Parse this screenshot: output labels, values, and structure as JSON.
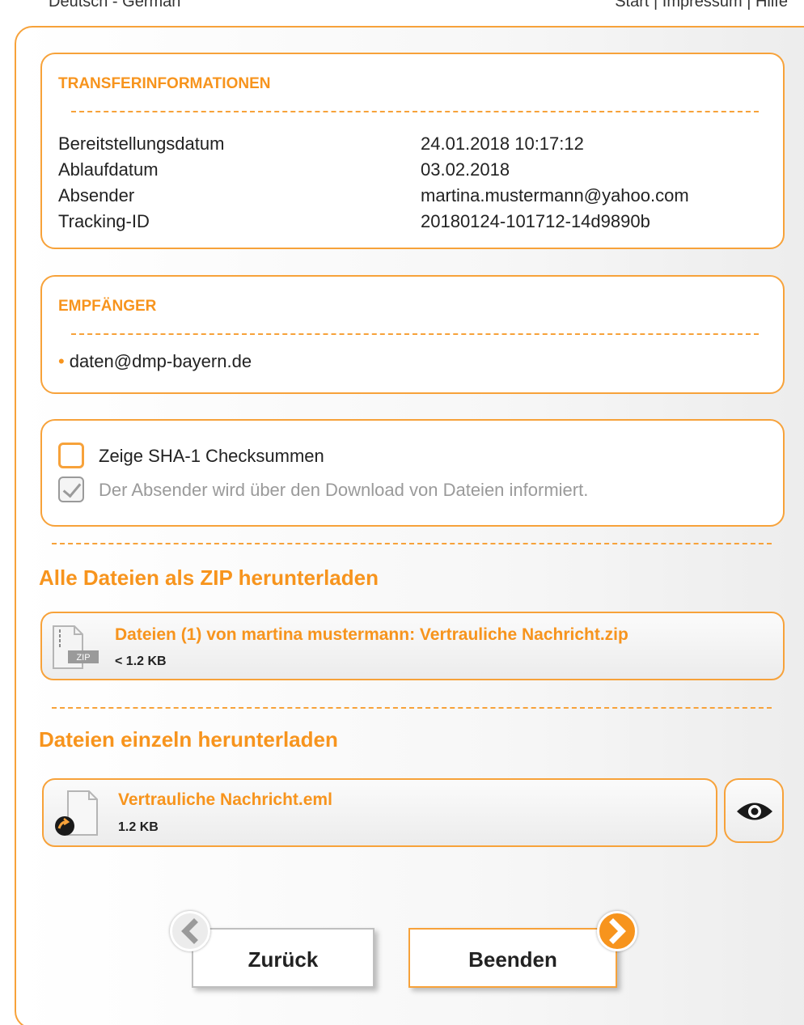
{
  "topbar": {
    "language": "Deutsch - German",
    "links": "Start | Impressum | Hilfe"
  },
  "transfer_info": {
    "title": "TRANSFERINFORMATIONEN",
    "rows": [
      {
        "label": "Bereitstellungsdatum",
        "value": "24.01.2018 10:17:12"
      },
      {
        "label": "Ablaufdatum",
        "value": "03.02.2018"
      },
      {
        "label": "Absender",
        "value": "martina.mustermann@yahoo.com"
      },
      {
        "label": "Tracking-ID",
        "value": "20180124-101712-14d9890b"
      }
    ]
  },
  "recipients": {
    "title": "EMPFÄNGER",
    "items": [
      "daten@dmp-bayern.de"
    ]
  },
  "options": {
    "sha1_label": "Zeige SHA-1 Checksummen",
    "sha1_checked": false,
    "notify_label": "Der Absender wird über den Download von Dateien informiert.",
    "notify_checked": true
  },
  "zip_section": {
    "heading": "Alle Dateien als ZIP herunterladen",
    "file": {
      "name": "Dateien (1) von martina mustermann: Vertrauliche Nachricht.zip",
      "size": "< 1.2 KB",
      "icon": "zip-file-icon",
      "icon_text": "ZIP"
    }
  },
  "single_section": {
    "heading": "Dateien einzeln herunterladen",
    "file": {
      "name": "Vertrauliche Nachricht.eml",
      "size": "1.2 KB",
      "icon": "email-file-icon"
    },
    "preview_icon": "eye-icon"
  },
  "buttons": {
    "back": "Zurück",
    "finish": "Beenden"
  },
  "colors": {
    "accent": "#f7941d",
    "border": "#f7a23a",
    "disabled": "#9a9a9a"
  }
}
